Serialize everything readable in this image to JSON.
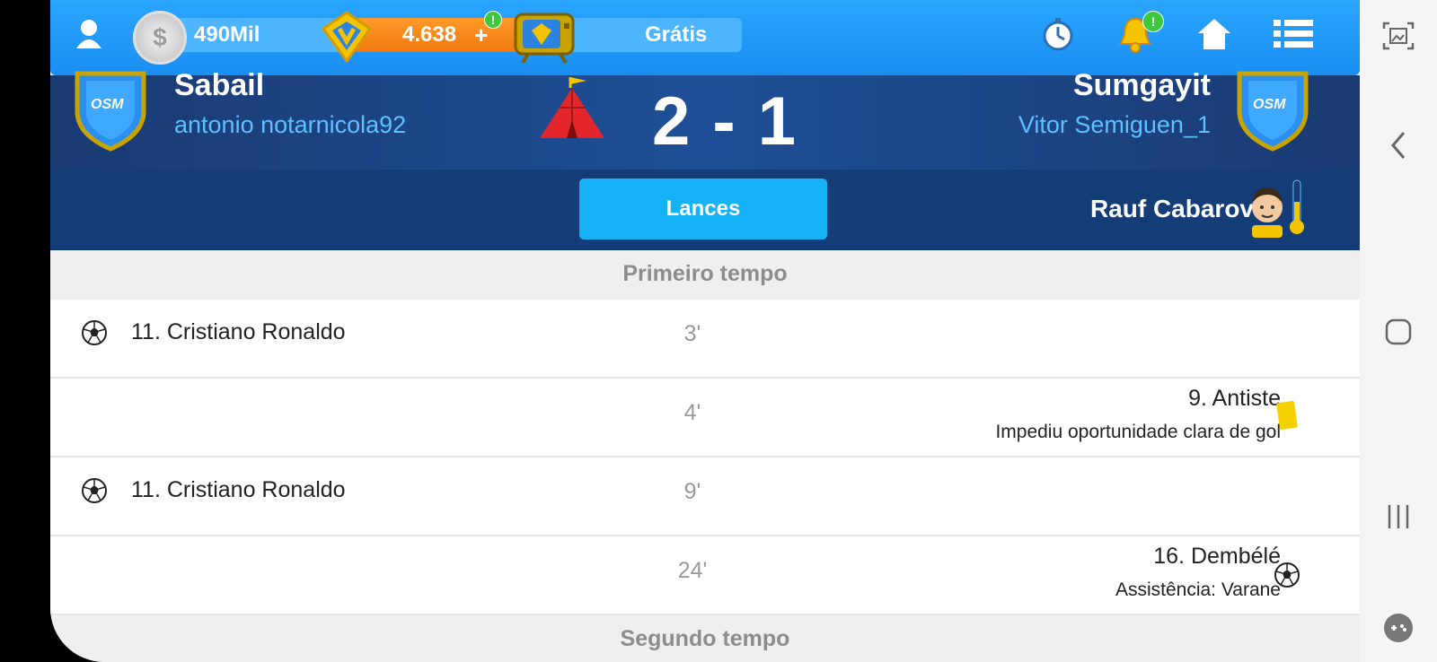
{
  "topbar": {
    "coins": "490Mil",
    "gems": "4.638",
    "gems_plus": "+",
    "free_label": "Grátis",
    "badge_mark": "!"
  },
  "match": {
    "home_team": "Sabail",
    "home_manager": "antonio notarnicola92",
    "score": "2 - 1",
    "away_team": "Sumgayit",
    "away_manager": "Vitor Semiguen_1",
    "crest_label": "OSM"
  },
  "tabs": {
    "active": "Lances",
    "referee": "Rauf Cabarov"
  },
  "sections": {
    "first_half": "Primeiro tempo",
    "second_half": "Segundo tempo"
  },
  "events": [
    {
      "side": "home",
      "type": "goal",
      "player": "11. Cristiano Ronaldo",
      "minute": "3'"
    },
    {
      "side": "away",
      "type": "yellow-card",
      "player": "9. Antiste",
      "detail": "Impediu oportunidade clara de gol",
      "minute": "4'"
    },
    {
      "side": "home",
      "type": "goal",
      "player": "11. Cristiano Ronaldo",
      "minute": "9'"
    },
    {
      "side": "away",
      "type": "goal",
      "player": "16. Dembélé",
      "detail": "Assistência: Varane",
      "minute": "24'"
    }
  ],
  "icons": {
    "profile": "user-icon",
    "coin": "coin-icon",
    "gem": "gem-icon",
    "tv": "tv-icon",
    "timer": "stopwatch-icon",
    "bell": "bell-icon",
    "home": "home-icon",
    "menu": "menu-icon",
    "goal": "soccer-ball-icon",
    "card": "yellow-card-icon"
  },
  "colors": {
    "topbar": "#1a8ef2",
    "header": "#1e4f96",
    "tab_active": "#15b2f6",
    "manager_text": "#5fc0ff"
  }
}
